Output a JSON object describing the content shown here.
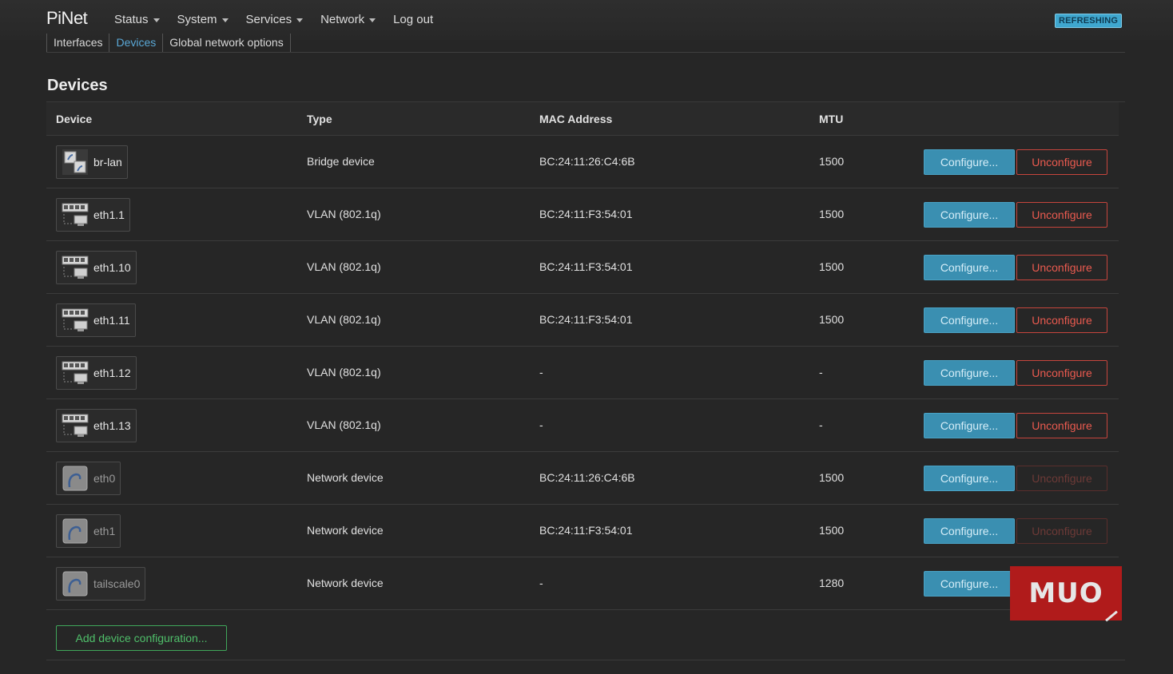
{
  "brand": "PiNet",
  "menu": [
    {
      "label": "Status",
      "dropdown": true
    },
    {
      "label": "System",
      "dropdown": true
    },
    {
      "label": "Services",
      "dropdown": true
    },
    {
      "label": "Network",
      "dropdown": true
    },
    {
      "label": "Log out",
      "dropdown": false
    }
  ],
  "badge": "REFRESHING",
  "tabs": [
    {
      "label": "Interfaces",
      "active": false
    },
    {
      "label": "Devices",
      "active": true
    },
    {
      "label": "Global network options",
      "active": false
    }
  ],
  "section_title": "Devices",
  "columns": {
    "device": "Device",
    "type": "Type",
    "mac": "MAC Address",
    "mtu": "MTU"
  },
  "devices": [
    {
      "name": "br-lan",
      "icon": "bridge-icon",
      "type": "Bridge device",
      "mac": "BC:24:11:26:C4:6B",
      "mtu": "1500",
      "unconfigure_enabled": true
    },
    {
      "name": "eth1.1",
      "icon": "vlan-icon",
      "type": "VLAN (802.1q)",
      "mac": "BC:24:11:F3:54:01",
      "mtu": "1500",
      "unconfigure_enabled": true
    },
    {
      "name": "eth1.10",
      "icon": "vlan-icon",
      "type": "VLAN (802.1q)",
      "mac": "BC:24:11:F3:54:01",
      "mtu": "1500",
      "unconfigure_enabled": true
    },
    {
      "name": "eth1.11",
      "icon": "vlan-icon",
      "type": "VLAN (802.1q)",
      "mac": "BC:24:11:F3:54:01",
      "mtu": "1500",
      "unconfigure_enabled": true
    },
    {
      "name": "eth1.12",
      "icon": "vlan-icon",
      "type": "VLAN (802.1q)",
      "mac": "-",
      "mtu": "-",
      "unconfigure_enabled": true
    },
    {
      "name": "eth1.13",
      "icon": "vlan-icon",
      "type": "VLAN (802.1q)",
      "mac": "-",
      "mtu": "-",
      "unconfigure_enabled": true
    },
    {
      "name": "eth0",
      "icon": "ethernet-port-icon",
      "type": "Network device",
      "mac": "BC:24:11:26:C4:6B",
      "mtu": "1500",
      "unconfigure_enabled": false
    },
    {
      "name": "eth1",
      "icon": "ethernet-port-icon",
      "type": "Network device",
      "mac": "BC:24:11:F3:54:01",
      "mtu": "1500",
      "unconfigure_enabled": false
    },
    {
      "name": "tailscale0",
      "icon": "ethernet-port-icon",
      "type": "Network device",
      "mac": "-",
      "mtu": "1280",
      "unconfigure_enabled": false
    }
  ],
  "buttons": {
    "configure": "Configure...",
    "unconfigure": "Unconfigure",
    "add": "Add device configuration..."
  },
  "watermark": "MUO",
  "colors": {
    "configure": "#3a8fb1",
    "unconfigure": "#ea5a4f",
    "add": "#4fbf6a",
    "active_tab": "#5aa8d6"
  }
}
